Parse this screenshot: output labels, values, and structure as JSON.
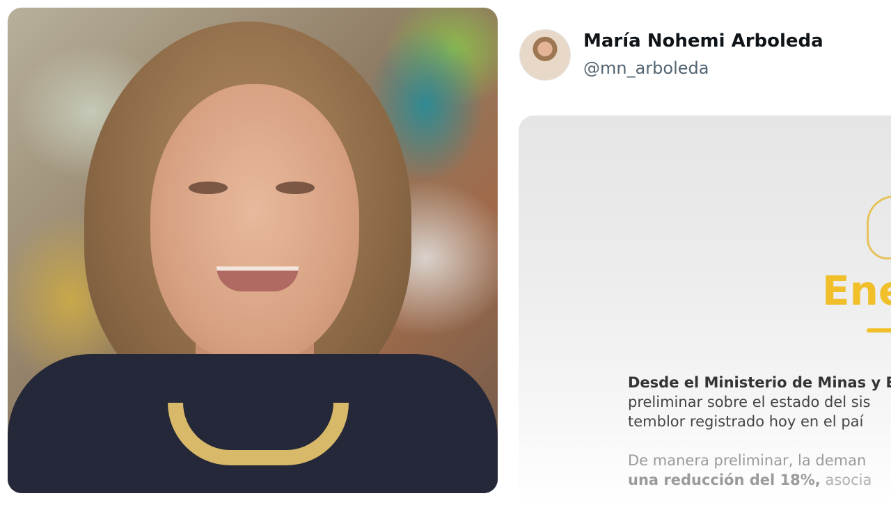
{
  "profile": {
    "name": "María Nohemi Arboleda",
    "handle": "@mn_arboleda"
  },
  "card": {
    "heading": "Ene",
    "lines": [
      "Desde el Ministerio de Minas y E",
      "preliminar sobre el estado del sis",
      "temblor registrado hoy en el paí",
      "De manera preliminar, la deman"
    ],
    "line5_bold": "una reducción del 18%,",
    "line5_rest": " asocia"
  },
  "colors": {
    "heading_accent": "#f0bf2a",
    "name_text": "#0f1419",
    "handle_text": "#536471"
  }
}
